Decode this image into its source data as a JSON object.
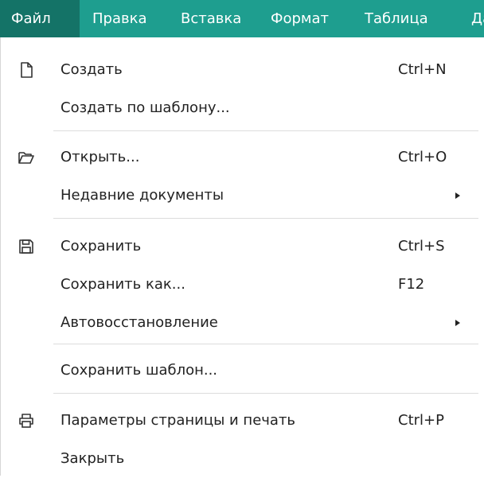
{
  "menubar": {
    "items": [
      {
        "label": "Файл",
        "active": true
      },
      {
        "label": "Правка"
      },
      {
        "label": "Вставка"
      },
      {
        "label": "Формат"
      },
      {
        "label": "Таблица"
      },
      {
        "label": "Да"
      }
    ],
    "accent_color": "#1e9e8f",
    "active_color": "#147367"
  },
  "file_menu": {
    "items": [
      {
        "label": "Создать",
        "shortcut": "Ctrl+N",
        "icon": "new-document-icon"
      },
      {
        "label": "Создать по шаблону..."
      },
      {
        "label": "Открыть...",
        "shortcut": "Ctrl+O",
        "icon": "open-folder-icon"
      },
      {
        "label": "Недавние документы",
        "has_submenu": true
      },
      {
        "label": "Сохранить",
        "shortcut": "Ctrl+S",
        "icon": "save-icon"
      },
      {
        "label": "Сохранить как...",
        "shortcut": "F12"
      },
      {
        "label": "Автовосстановление",
        "has_submenu": true
      },
      {
        "label": "Сохранить шаблон..."
      },
      {
        "label": "Параметры страницы и печать",
        "shortcut": "Ctrl+P",
        "icon": "printer-icon"
      },
      {
        "label": "Закрыть"
      }
    ]
  }
}
